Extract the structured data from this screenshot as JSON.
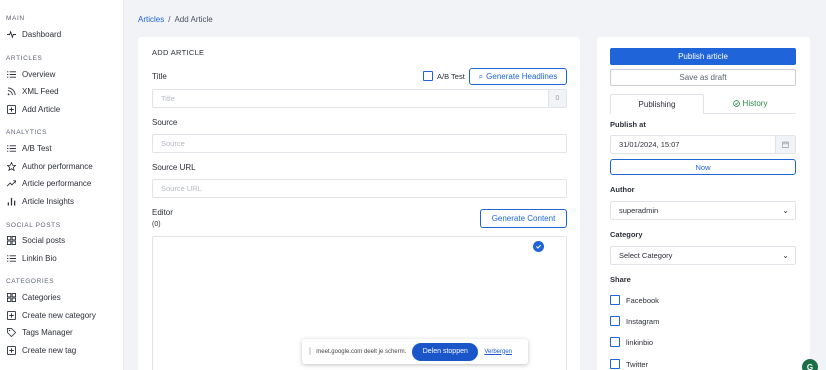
{
  "sidebar": {
    "sections": [
      {
        "title": "MAIN",
        "items": [
          {
            "label": "Dashboard",
            "icon": "pulse-icon"
          }
        ]
      },
      {
        "title": "ARTICLES",
        "items": [
          {
            "label": "Overview",
            "icon": "list-icon"
          },
          {
            "label": "XML Feed",
            "icon": "rss-icon"
          },
          {
            "label": "Add Article",
            "icon": "plus-square-icon"
          }
        ]
      },
      {
        "title": "ANALYTICS",
        "items": [
          {
            "label": "A/B Test",
            "icon": "list-icon"
          },
          {
            "label": "Author performance",
            "icon": "star-icon"
          },
          {
            "label": "Article performance",
            "icon": "trend-icon"
          },
          {
            "label": "Article Insights",
            "icon": "bar-chart-icon"
          }
        ]
      },
      {
        "title": "SOCIAL POSTS",
        "items": [
          {
            "label": "Social posts",
            "icon": "grid-icon"
          },
          {
            "label": "Linkin Bio",
            "icon": "list-icon"
          }
        ]
      },
      {
        "title": "CATEGORIES",
        "items": [
          {
            "label": "Categories",
            "icon": "grid-icon"
          },
          {
            "label": "Create new category",
            "icon": "plus-square-icon"
          },
          {
            "label": "Tags Manager",
            "icon": "tag-icon"
          },
          {
            "label": "Create new tag",
            "icon": "plus-square-icon"
          }
        ]
      }
    ]
  },
  "breadcrumb": {
    "parent": "Articles",
    "separator": "/",
    "current": "Add Article"
  },
  "form": {
    "heading": "ADD ARTICLE",
    "title_label": "Title",
    "title_placeholder": "Title",
    "title_count": "0",
    "ab_test_label": "A/B Test",
    "generate_headlines": "Generate Headlines",
    "source_label": "Source",
    "source_placeholder": "Source",
    "source_url_label": "Source URL",
    "source_url_placeholder": "Source URL",
    "editor_label": "Editor",
    "editor_count": "(0)",
    "generate_content": "Generate Content"
  },
  "side": {
    "publish_button": "Publish article",
    "draft_button": "Save as draft",
    "tab_publishing": "Publishing",
    "tab_history": "History",
    "publish_at_label": "Publish at",
    "publish_at_value": "31/01/2024, 15:07",
    "now_button": "Now",
    "author_label": "Author",
    "author_value": "superadmin",
    "category_label": "Category",
    "category_value": "Select Category",
    "share_label": "Share",
    "share_options": [
      "Facebook",
      "Instagram",
      "linkinbio",
      "Twitter"
    ]
  },
  "screenshare": {
    "message": "meet.google.com deelt je scherm.",
    "stop": "Delen stoppen",
    "hide": "Verbergen"
  },
  "colors": {
    "accent": "#1f64d8",
    "background": "#f1f3f6"
  }
}
